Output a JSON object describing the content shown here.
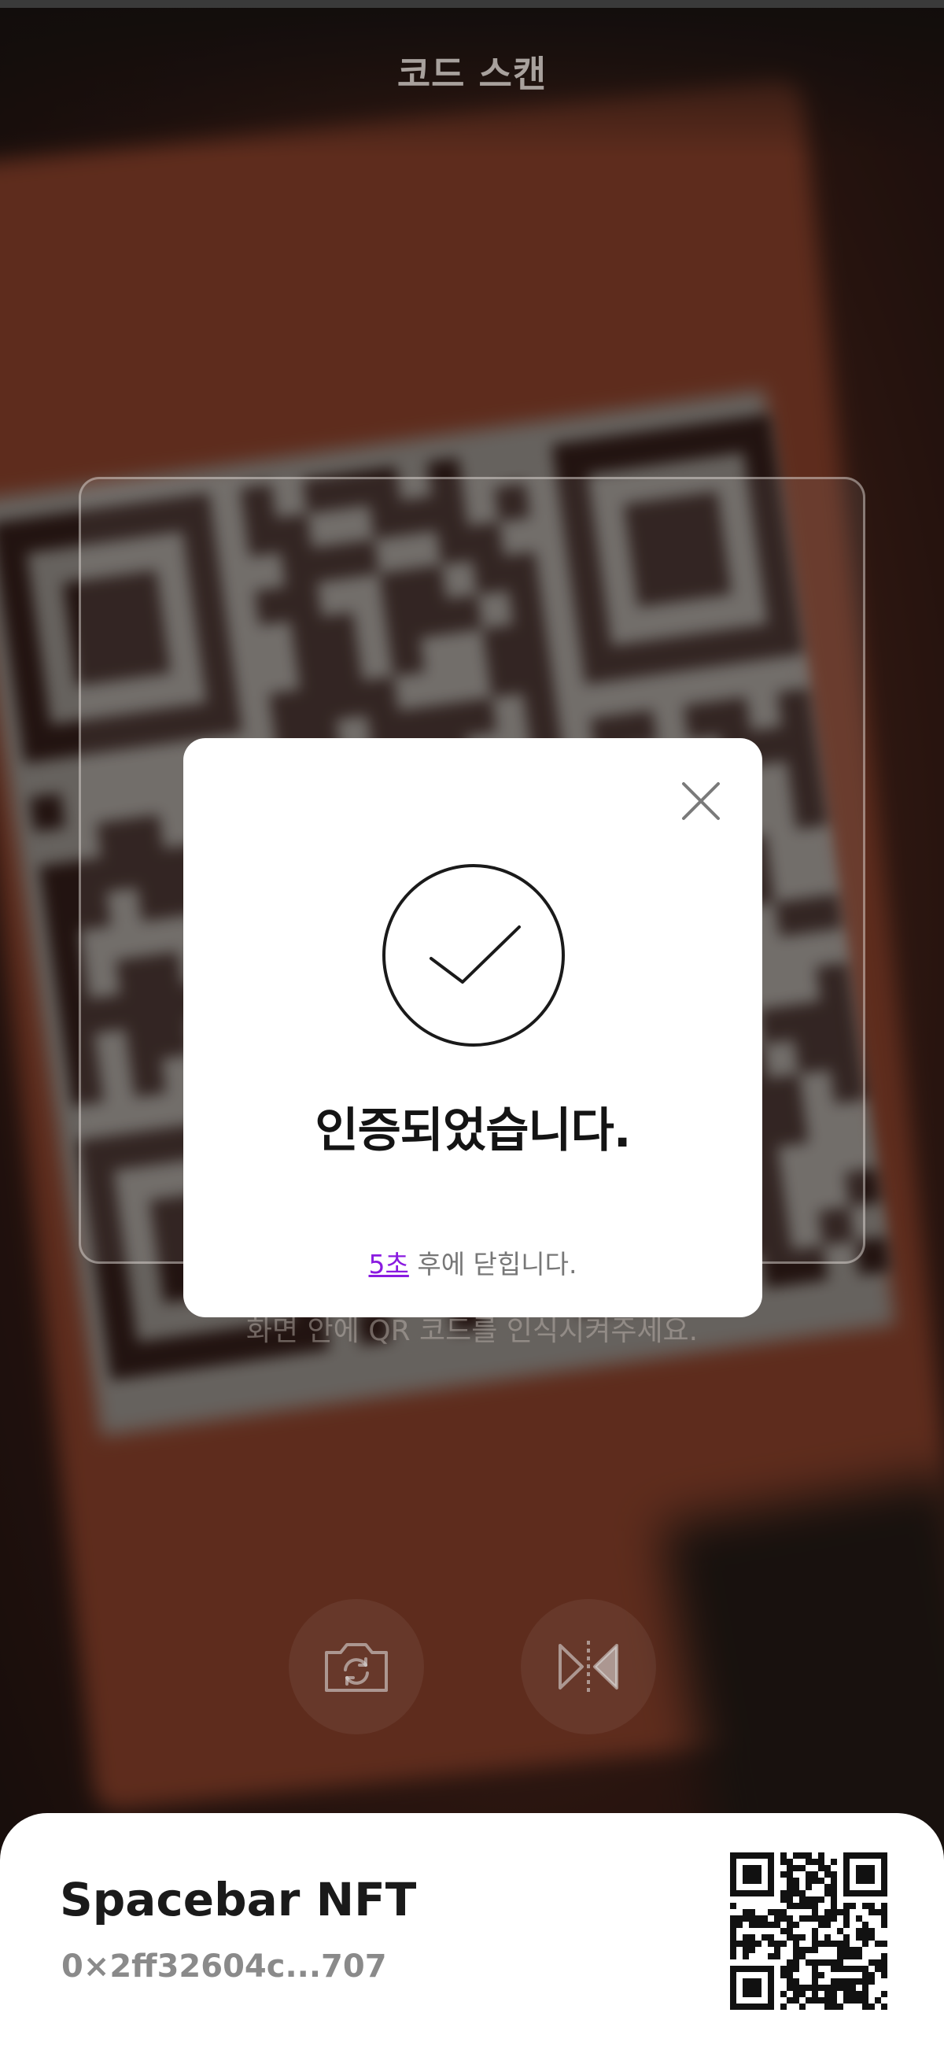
{
  "header": {
    "title": "코드 스캔"
  },
  "scanner": {
    "hint": "화면 안에 QR 코드를 인식시켜주세요.",
    "controls": [
      {
        "name": "switch-camera",
        "icon": "camera-flip-icon"
      },
      {
        "name": "mirror",
        "icon": "mirror-flip-icon"
      }
    ]
  },
  "modal": {
    "icon": "check-circle-icon",
    "title": "인증되었습니다.",
    "countdown_seconds": "5초",
    "countdown_suffix": " 후에 닫힙니다.",
    "close_icon": "close-icon",
    "accent_color": "#8a1be0"
  },
  "sheet": {
    "name": "Spacebar NFT",
    "address": "0×2ff32604c...707",
    "qr_icon": "qr-code-icon"
  }
}
